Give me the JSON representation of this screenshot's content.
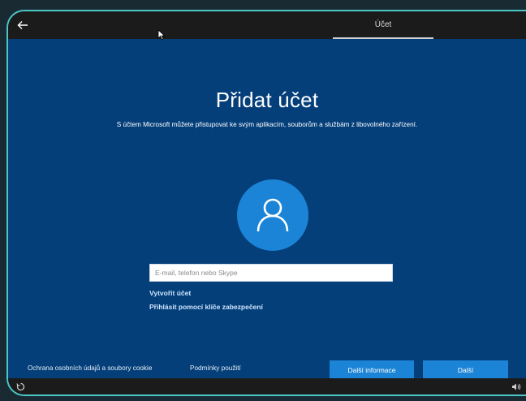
{
  "header": {
    "back_icon": "arrow-left-icon",
    "tab_label": "Účet"
  },
  "main": {
    "title": "Přidat účet",
    "subtitle": "S účtem Microsoft můžete přistupovat ke svým aplikacím, souborům a službám z libovolného zařízení.",
    "avatar_icon": "user-icon",
    "email_placeholder": "E-mail, telefon nebo Skype",
    "email_value": "",
    "create_account_link": "Vytvořit účet",
    "security_key_link": "Přihlásit pomocí klíče zabezpečení"
  },
  "footer": {
    "privacy_link": "Ochrana osobních údajů a soubory cookie",
    "terms_link": "Podmínky použití",
    "more_info_button": "Další informace",
    "next_button": "Další"
  },
  "taskbar": {
    "left_icon": "accessibility-icon",
    "right_icon": "volume-icon"
  },
  "colors": {
    "background": "#043f7a",
    "accent": "#1b84d6",
    "frame_border": "#4cc7c7",
    "bar": "#1b1b1b"
  }
}
